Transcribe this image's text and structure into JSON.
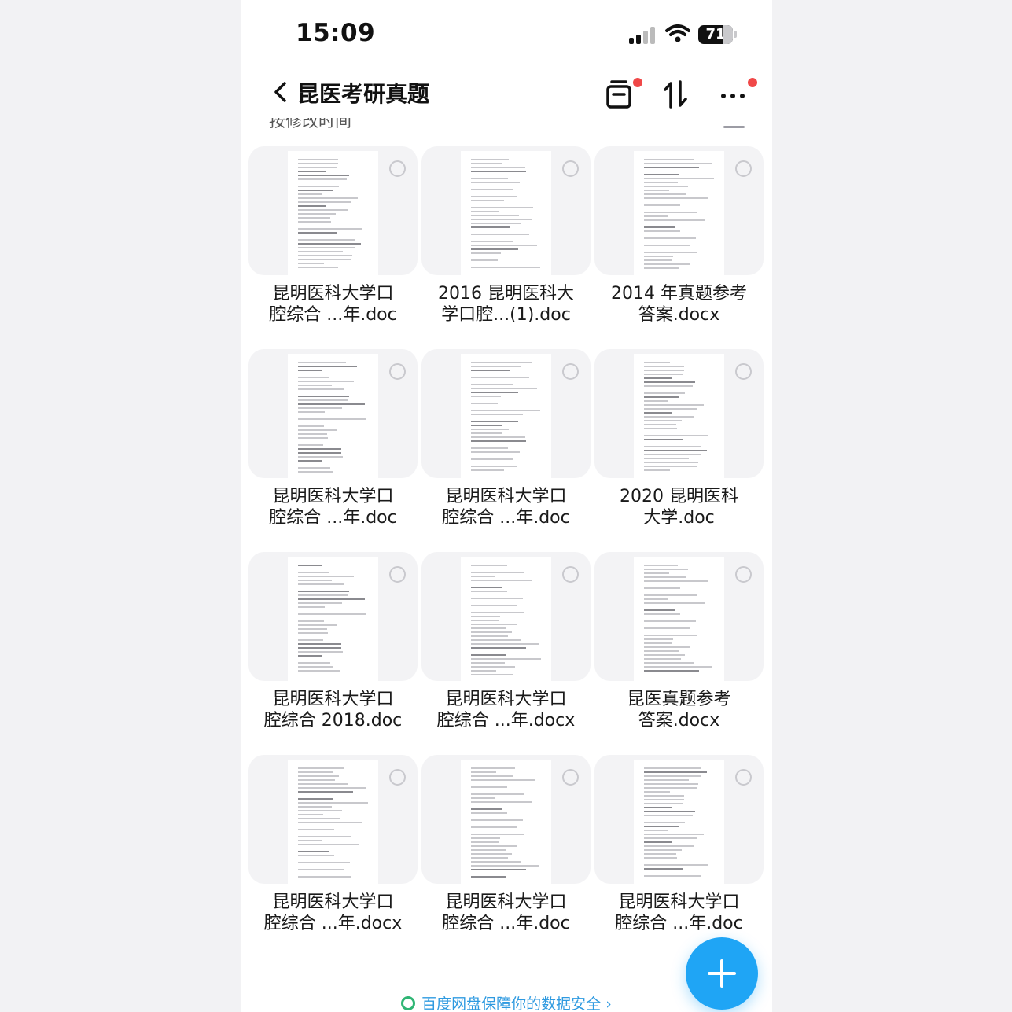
{
  "status_bar": {
    "time": "15:09",
    "battery": "71"
  },
  "nav": {
    "title": "昆医考研真题"
  },
  "sort": {
    "label": "按修改时间"
  },
  "files": [
    {
      "line1": "昆明医科大学口",
      "line2": "腔综合 ...年.doc"
    },
    {
      "line1": "2016 昆明医科大",
      "line2": "学口腔...(1).doc"
    },
    {
      "line1": "2014 年真题参考",
      "line2": "答案.docx"
    },
    {
      "line1": "昆明医科大学口",
      "line2": "腔综合 ...年.doc"
    },
    {
      "line1": "昆明医科大学口",
      "line2": "腔综合 ...年.doc"
    },
    {
      "line1": "2020 昆明医科",
      "line2": "大学.doc"
    },
    {
      "line1": "昆明医科大学口",
      "line2": "腔综合 2018.doc"
    },
    {
      "line1": "昆明医科大学口",
      "line2": "腔综合 ...年.docx"
    },
    {
      "line1": "昆医真题参考",
      "line2": "答案.docx"
    },
    {
      "line1": "昆明医科大学口",
      "line2": "腔综合 ...年.docx"
    },
    {
      "line1": "昆明医科大学口",
      "line2": "腔综合 ...年.doc"
    },
    {
      "line1": "昆明医科大学口",
      "line2": "腔综合 ...年.doc"
    }
  ],
  "banner": {
    "text": "百度网盘保障你的数据安全 ›"
  },
  "colors": {
    "accent": "#1fa5f5",
    "badge": "#f04848",
    "banner": "#2f9ae0"
  }
}
